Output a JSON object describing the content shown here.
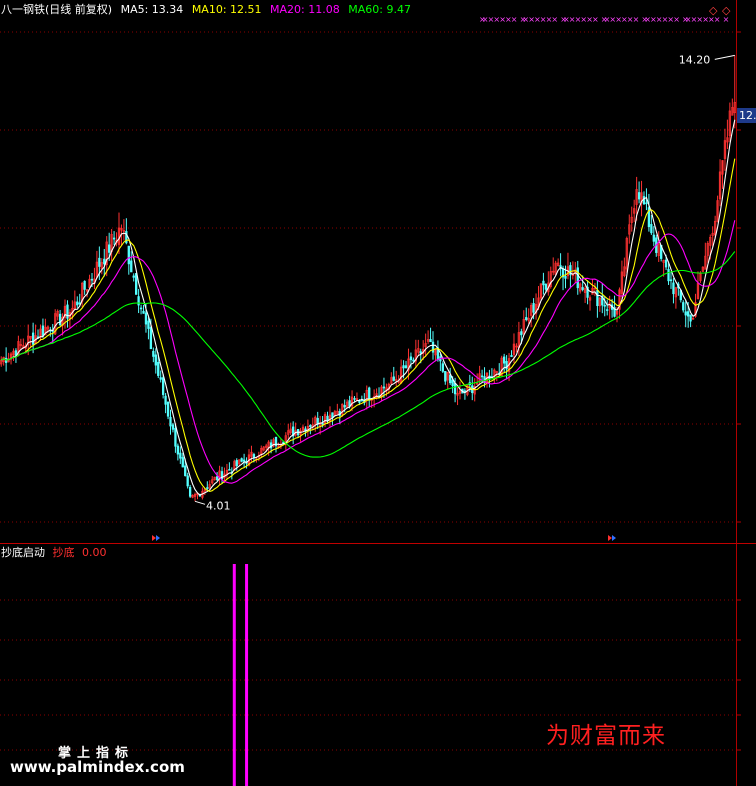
{
  "header": {
    "stock": "八一钢铁(日线 前复权)",
    "ma5": "MA5: 13.34",
    "ma10": "MA10: 12.51",
    "ma20": "MA20: 11.08",
    "ma60": "MA60: 9.47"
  },
  "sub_header": {
    "name": "抄底启动",
    "series": "抄底",
    "value": "0.00"
  },
  "annotations": {
    "high": "14.20",
    "low": "4.01",
    "price_tag": "12.5"
  },
  "slogan": "为财富而来",
  "watermark": {
    "line1": "掌上指标",
    "line2": "www.palmindex.com"
  },
  "colors": {
    "background": "#000000",
    "up": "#ff3232",
    "down": "#54ffff",
    "ma5": "#ffffff",
    "ma10": "#ffff00",
    "ma20": "#ff00ff",
    "ma60": "#00ff00",
    "grid": "#8b0000",
    "signal": "#ff00ff"
  },
  "chart_data": {
    "type": "line",
    "price_range": [
      3.4,
      15.1
    ],
    "high": 14.2,
    "low": 4.01,
    "segments": [
      {
        "bars": 30,
        "from": 7.2,
        "to": 8.4
      },
      {
        "bars": 20,
        "from": 8.4,
        "to": 10.3
      },
      {
        "bars": 10,
        "from": 10.3,
        "to": 8.0
      },
      {
        "bars": 18,
        "from": 8.0,
        "to": 4.05
      },
      {
        "bars": 12,
        "from": 4.05,
        "to": 4.6
      },
      {
        "bars": 30,
        "from": 4.6,
        "to": 5.6
      },
      {
        "bars": 40,
        "from": 5.6,
        "to": 6.7
      },
      {
        "bars": 15,
        "from": 6.7,
        "to": 7.6
      },
      {
        "bars": 12,
        "from": 7.6,
        "to": 6.4
      },
      {
        "bars": 20,
        "from": 6.4,
        "to": 7.2
      },
      {
        "bars": 20,
        "from": 7.2,
        "to": 9.5
      },
      {
        "bars": 25,
        "from": 9.5,
        "to": 8.3
      },
      {
        "bars": 8,
        "from": 8.3,
        "to": 11.3
      },
      {
        "bars": 10,
        "from": 11.3,
        "to": 9.5
      },
      {
        "bars": 12,
        "from": 9.5,
        "to": 8.1
      },
      {
        "bars": 10,
        "from": 8.1,
        "to": 10.6
      },
      {
        "bars": 8,
        "from": 10.6,
        "to": 13.4
      }
    ],
    "series": [
      {
        "name": "MA5",
        "period": 5,
        "color": "#ffffff"
      },
      {
        "name": "MA10",
        "period": 10,
        "color": "#ffff00"
      },
      {
        "name": "MA20",
        "period": 20,
        "color": "#ff00ff"
      },
      {
        "name": "MA60",
        "period": 60,
        "color": "#00ff00"
      }
    ],
    "signals": [
      {
        "name": "抄底",
        "bar_index": 95,
        "color": "#ff00ff"
      },
      {
        "name": "抄底",
        "bar_index": 100,
        "color": "#ff00ff"
      }
    ]
  }
}
